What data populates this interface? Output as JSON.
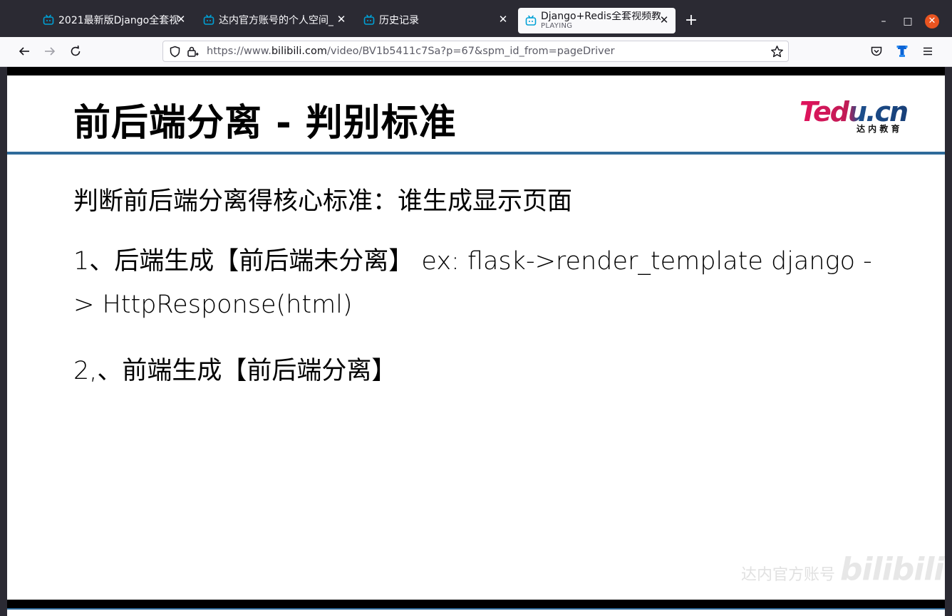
{
  "browser": {
    "tabs": [
      {
        "title": "2021最新版Django全套视",
        "subtitle": "",
        "active": false
      },
      {
        "title": "达内官方账号的个人空间_",
        "subtitle": "",
        "active": false
      },
      {
        "title": "历史记录",
        "subtitle": "",
        "active": false
      },
      {
        "title": "Django+Redis全套视频教",
        "subtitle": "PLAYING",
        "active": true
      }
    ],
    "new_tab_label": "+",
    "window_controls": {
      "minimize": "–",
      "maximize": "□",
      "close": "✕"
    },
    "url": {
      "prefix": "https://www.",
      "host": "bilibili.com",
      "path": "/video/BV1b5411c7Sa?p=67&spm_id_from=pageDriver"
    },
    "icons": {
      "tab_favicon": "bilibili-tv-icon",
      "back": "arrow-left-icon",
      "forward": "arrow-right-icon",
      "reload": "reload-icon",
      "shield": "tracking-shield-icon",
      "lock": "lock-icon",
      "bookmark": "star-icon",
      "pocket": "pocket-icon",
      "extension": "extension-icon",
      "menu": "hamburger-menu-icon"
    },
    "accent_color": "#00a1d6"
  },
  "slide": {
    "title": "前后端分离 - 判别标准",
    "logo": {
      "brand": "Tedu.cn",
      "tagline": "达 内 教 育"
    },
    "lines": [
      "判断前后端分离得核心标准：谁生成显示页面",
      "1、后端生成【前后端未分离】 ex: flask->render_template django -",
      "> HttpResponse(html)",
      "2,、前端生成【前后端分离】"
    ],
    "watermark": {
      "text": "达内官方账号",
      "brand": "bilibili"
    },
    "rule_color": "#2f6b9a"
  }
}
